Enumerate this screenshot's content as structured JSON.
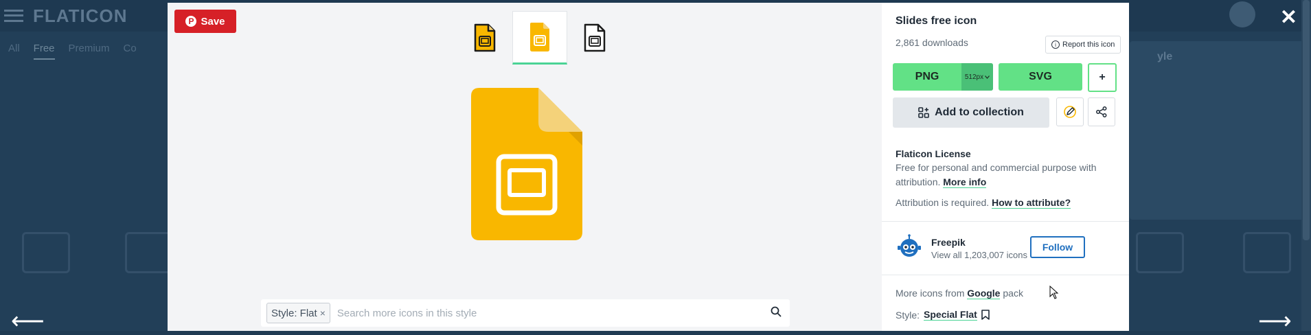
{
  "background": {
    "logo": "FLATICON",
    "tabs": [
      "All",
      "Free",
      "Premium",
      "Co"
    ],
    "right_panel_text": "yle"
  },
  "modal": {
    "save_label": "Save",
    "thumbnails": [
      "slides-outline-yellow-icon",
      "slides-flat-yellow-icon",
      "slides-outline-black-icon"
    ],
    "search": {
      "chip_label": "Style: Flat",
      "chip_remove": "×",
      "placeholder": "Search more icons in this style"
    },
    "detail": {
      "title": "Slides free icon",
      "downloads": "2,861 downloads",
      "report_label": "Report this icon",
      "png_label": "PNG",
      "png_size": "512px",
      "svg_label": "SVG",
      "plus_label": "+",
      "collection_label": "Add to collection",
      "license_title": "Flaticon License",
      "license_desc": "Free for personal and commercial purpose with attribution.",
      "more_info_label": "More info",
      "attribution_text": "Attribution is required.",
      "how_to_attribute_label": "How to attribute?",
      "author_name": "Freepik",
      "author_sub": "View all 1,203,007 icons",
      "follow_label": "Follow",
      "more_icons_prefix": "More icons from",
      "pack_name": "Google",
      "more_icons_suffix": "pack",
      "style_prefix": "Style:",
      "style_name": "Special Flat"
    }
  },
  "colors": {
    "accent_green": "#62e186",
    "pinterest_red": "#d62027",
    "icon_yellow": "#f9b700",
    "follow_blue": "#1f6fbf"
  }
}
